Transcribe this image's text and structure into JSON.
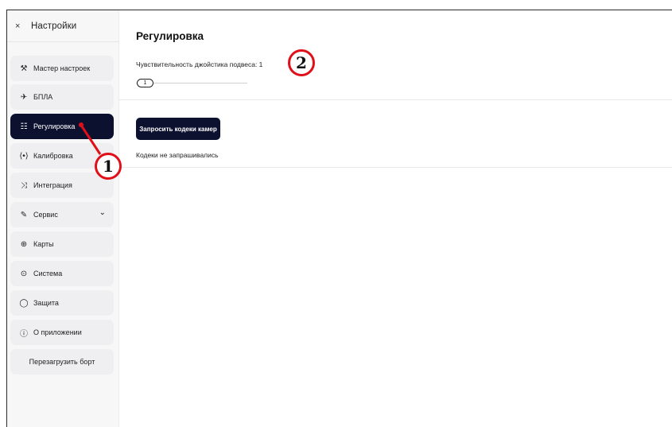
{
  "sidebar": {
    "close_icon": "×",
    "title": "Настройки",
    "items": [
      {
        "label": "Мастер настроек",
        "icon": "wizard-icon",
        "glyph": "⚒"
      },
      {
        "label": "БПЛА",
        "icon": "airplane-icon",
        "glyph": "✈"
      },
      {
        "label": "Регулировка",
        "icon": "sliders-icon",
        "glyph": "☷",
        "active": true
      },
      {
        "label": "Калибровка",
        "icon": "signal-icon",
        "glyph": "⟨•⟩"
      },
      {
        "label": "Интеграция",
        "icon": "shuffle-icon",
        "glyph": "⤨"
      },
      {
        "label": "Сервис",
        "icon": "wrench-icon",
        "glyph": "✎",
        "chevron": "⌄"
      },
      {
        "label": "Карты",
        "icon": "globe-icon",
        "glyph": "⊕"
      },
      {
        "label": "Система",
        "icon": "cpu-icon",
        "glyph": "⊙"
      },
      {
        "label": "Защита",
        "icon": "shield-icon",
        "glyph": "◯"
      },
      {
        "label": "О приложении",
        "icon": "info-icon",
        "glyph": "ⓘ"
      },
      {
        "label": "Перезагрузить борт"
      }
    ]
  },
  "main": {
    "title": "Регулировка",
    "sensitivity_label": "Чувствительность джойстика подвеса: 1",
    "slider": {
      "value": "1",
      "fraction": 0.0
    },
    "request_button": "Запросить кодеки камер",
    "codes_status": "Кодеки не запрашивались"
  },
  "annotations": {
    "marker_1": "1",
    "marker_2": "2",
    "color": "#e0101a"
  },
  "colors": {
    "active_bg": "#0d1130",
    "item_bg": "#efeff1",
    "sidebar_bg": "#f7f7f8"
  }
}
